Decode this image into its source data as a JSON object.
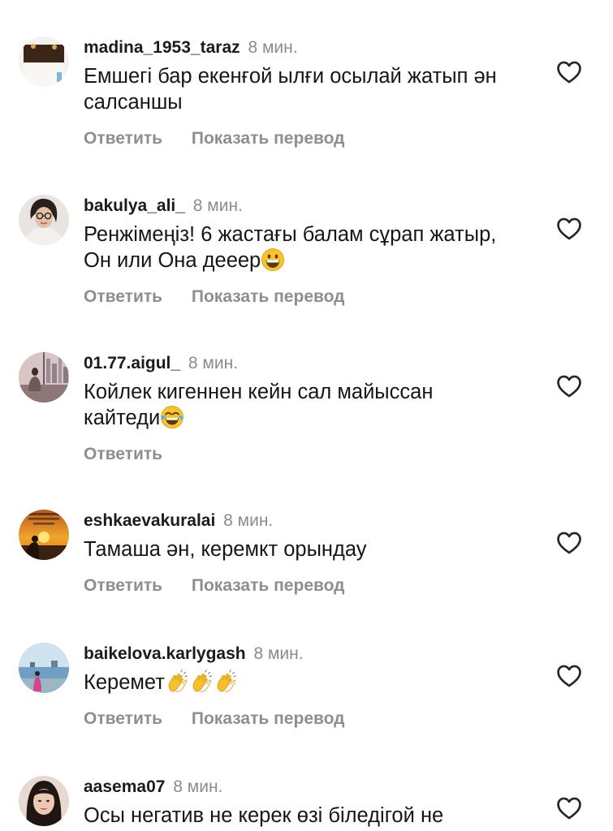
{
  "comments": [
    {
      "username": "madina_1953_taraz",
      "time": "8 мин.",
      "text": "Емшегі бар екенғой ылғи осылай жатып ән салсаншы",
      "reply_label": "Ответить",
      "translate_label": "Показать перевод",
      "avatar_icon": "avatar-cake-photo"
    },
    {
      "username": "bakulya_ali_",
      "time": "8 мин.",
      "text": "Ренжімеңіз! 6 жастағы балам сұрап жатыр, Он или Она дееep",
      "reply_label": "Ответить",
      "translate_label": "Показать перевод",
      "emoji": "grinning-face-emoji",
      "avatar_icon": "avatar-woman-glasses-photo"
    },
    {
      "username": "01.77.aigul_",
      "time": "8 мин.",
      "text": "Койлек кигеннен кейн сал майыссан кайтеди",
      "reply_label": "Ответить",
      "emoji": "tears-of-joy-emoji",
      "avatar_icon": "avatar-window-city-photo"
    },
    {
      "username": "eshkaevakuralai",
      "time": "8 мин.",
      "text": "Тамаша ән, керемкт орындау",
      "reply_label": "Ответить",
      "translate_label": "Показать перевод",
      "avatar_icon": "avatar-sunset-photo"
    },
    {
      "username": "baikelova.karlygash",
      "time": "8 мин.",
      "text": "Керемет",
      "reply_label": "Ответить",
      "translate_label": "Показать перевод",
      "emoji": "clapping-hands-emoji-x3",
      "avatar_icon": "avatar-sea-photo"
    },
    {
      "username": "aasema07",
      "time": "8 мин.",
      "text": "Осы негатив не керек өзі біледігой не",
      "avatar_icon": "avatar-woman-portrait-photo"
    }
  ],
  "colors": {
    "username": "#1b1b1b",
    "meta": "#8b8b8b",
    "action": "#8e8e8e",
    "text": "#161616",
    "heart_outline": "#262626"
  }
}
